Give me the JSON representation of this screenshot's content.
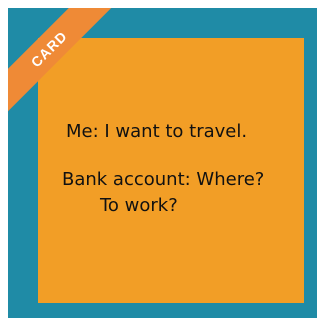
{
  "badge": {
    "label": "CARD"
  },
  "card_text": {
    "line1": "Me: I want to travel.",
    "line2": "Bank account: Where?",
    "line3": "To work?"
  },
  "colors": {
    "frame": "#1f8ba6",
    "card": "#f29e26",
    "ribbon": "#ef8a36",
    "text": "#111111"
  }
}
